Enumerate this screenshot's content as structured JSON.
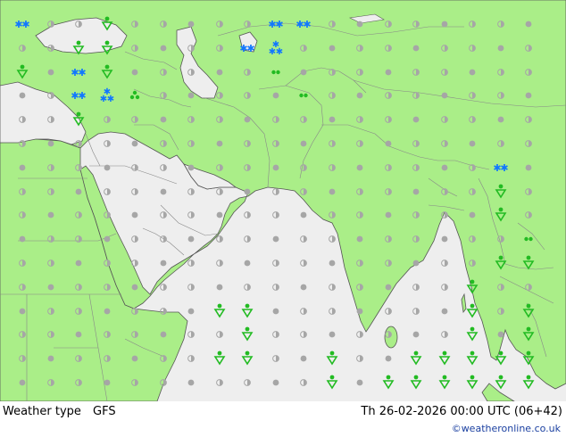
{
  "footer": {
    "product": "Weather type",
    "model": "GFS",
    "valid_time": "Th 26-02-2026 00:00 UTC (06+42)",
    "credit": "©weatheronline.co.uk"
  },
  "colors": {
    "land": "#aaee88",
    "sea": "#eeeeee",
    "border": "#888888",
    "coast": "#555555",
    "dot": "#a6a6a6",
    "rain": "#22bb22",
    "snow": "#1177ff"
  },
  "icons": {
    "dot": "dry-dot-icon",
    "rain_shower": "rain-shower-icon",
    "snow": "snow-icon",
    "heavy_snow": "heavy-snow-icon",
    "drizzle": "drizzle-icon",
    "hail": "hail-icon"
  }
}
